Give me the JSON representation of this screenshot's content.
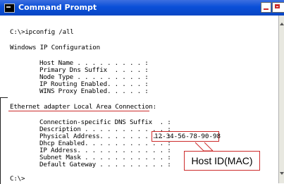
{
  "window": {
    "title": "Command Prompt"
  },
  "console": {
    "lines": [
      "C:\\>ipconfig /all",
      "Windows IP Configuration",
      "Host Name . . . . . . . . . :",
      "Primary Dns Suffix  . . . . :",
      "Node Type . . . . . . . . . :",
      "IP Routing Enabled. . . . . :",
      "WINS Proxy Enabled. . . . . :",
      "Ethernet adapter Local Area Connection:",
      "Connection-specific DNS Suffix  . :",
      "Description . . . . . . . . . . . :",
      "Physical Address. . . . . . . . . :",
      "Dhcp Enabled. . . . . . . . . . . :",
      "IP Address. . . . . . . . . . . . :",
      "Subnet Mask . . . . . . . . . . . :",
      "Default Gateway . . . . . . . . . :",
      "C:\\>"
    ],
    "mac_address": "12-34-56-78-90-98"
  },
  "annotation": {
    "callout_label": "Host ID(MAC)",
    "accent_color": "#cc2b2b"
  }
}
